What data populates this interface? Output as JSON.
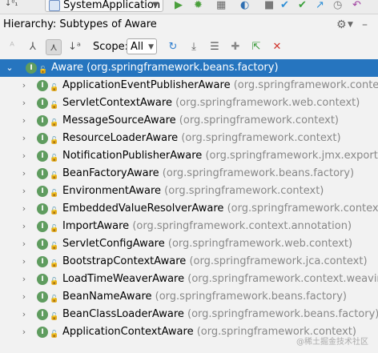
{
  "topbar": {
    "run_config": "SystemApplication"
  },
  "panel": {
    "title": "Hierarchy: Subtypes of Aware"
  },
  "toolbar": {
    "scope_label": "Scope:",
    "scope_value": "All"
  },
  "tree": {
    "root": {
      "name": "Aware",
      "package": "(org.springframework.beans.factory)"
    },
    "children": [
      {
        "name": "ApplicationEventPublisherAware",
        "package": "(org.springframework.context)"
      },
      {
        "name": "ServletContextAware",
        "package": "(org.springframework.web.context)"
      },
      {
        "name": "MessageSourceAware",
        "package": "(org.springframework.context)"
      },
      {
        "name": "ResourceLoaderAware",
        "package": "(org.springframework.context)"
      },
      {
        "name": "NotificationPublisherAware",
        "package": "(org.springframework.jmx.export.notifica"
      },
      {
        "name": "BeanFactoryAware",
        "package": "(org.springframework.beans.factory)"
      },
      {
        "name": "EnvironmentAware",
        "package": "(org.springframework.context)"
      },
      {
        "name": "EmbeddedValueResolverAware",
        "package": "(org.springframework.context)"
      },
      {
        "name": "ImportAware",
        "package": "(org.springframework.context.annotation)"
      },
      {
        "name": "ServletConfigAware",
        "package": "(org.springframework.web.context)"
      },
      {
        "name": "BootstrapContextAware",
        "package": "(org.springframework.jca.context)"
      },
      {
        "name": "LoadTimeWeaverAware",
        "package": "(org.springframework.context.weaving)"
      },
      {
        "name": "BeanNameAware",
        "package": "(org.springframework.beans.factory)"
      },
      {
        "name": "BeanClassLoaderAware",
        "package": "(org.springframework.beans.factory)"
      },
      {
        "name": "ApplicationContextAware",
        "package": "(org.springframework.context)"
      }
    ]
  },
  "watermark": "@稀土掘金技术社区",
  "colors": {
    "selection": "#2675bf",
    "package_text": "#888888",
    "interface_icon": "#5f9c5f"
  }
}
